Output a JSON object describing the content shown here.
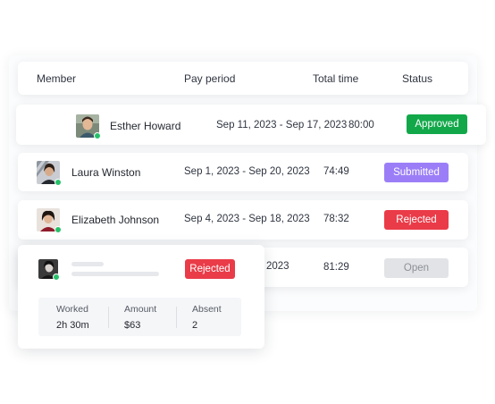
{
  "table": {
    "headers": {
      "member": "Member",
      "pay_period": "Pay period",
      "total_time": "Total time",
      "status": "Status"
    },
    "rows": [
      {
        "name": "Esther Howard",
        "pay_period": "Sep 11, 2023 - Sep 17, 2023",
        "total_time": "80:00",
        "status": "Approved"
      },
      {
        "name": "Laura Winston",
        "pay_period": "Sep 1, 2023 - Sep 20, 2023",
        "total_time": "74:49",
        "status": "Submitted"
      },
      {
        "name": "Elizabeth Johnson",
        "pay_period": "Sep 4, 2023 - Sep 18, 2023",
        "total_time": "78:32",
        "status": "Rejected"
      },
      {
        "name": "",
        "pay_period_partial": "2023",
        "total_time": "81:29",
        "status": "Open"
      }
    ]
  },
  "popup": {
    "status": "Rejected",
    "stats": [
      {
        "label": "Worked",
        "value": "2h 30m"
      },
      {
        "label": "Amount",
        "value": "$63"
      },
      {
        "label": "Absent",
        "value": "2"
      }
    ]
  },
  "colors": {
    "approved": "#12a84a",
    "submitted": "#9b7ef7",
    "rejected": "#ea3b48",
    "open": "#e1e3e6",
    "online": "#27c06a"
  }
}
